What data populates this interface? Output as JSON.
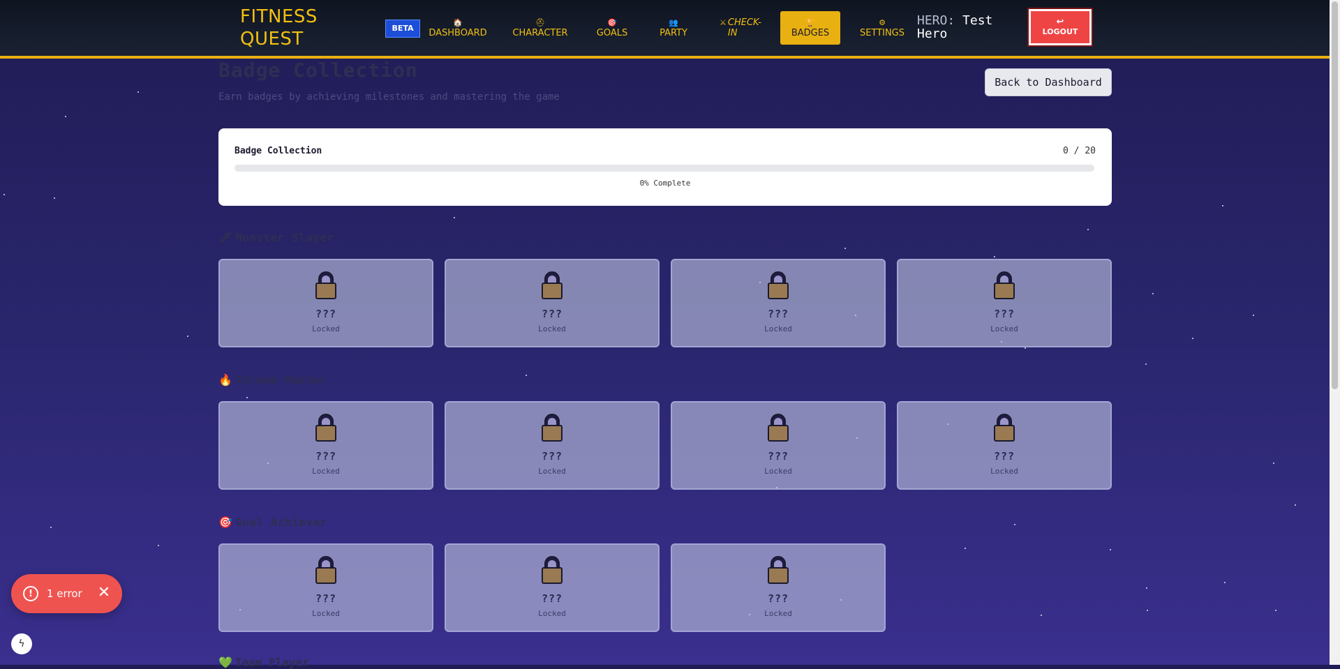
{
  "app": {
    "logo_line1": "FITNESS",
    "logo_line2": "QUEST",
    "beta_badge": "BETA"
  },
  "nav": [
    {
      "icon": "house-icon",
      "glyph": "🏠",
      "label": "DASHBOARD"
    },
    {
      "icon": "helmet-icon",
      "glyph": "⛑",
      "label": "CHARACTER"
    },
    {
      "icon": "target-icon",
      "glyph": "🎯",
      "label": "GOALS"
    },
    {
      "icon": "people-icon",
      "glyph": "👥",
      "label": "PARTY"
    },
    {
      "icon": "crossed-swords-icon",
      "glyph": "⚔",
      "label_line1": "CHECK-",
      "label_line2": "IN"
    },
    {
      "icon": "trophy-icon",
      "glyph": "🏆",
      "label": "BADGES"
    },
    {
      "icon": "gear-icon",
      "glyph": "⚙",
      "label": "SETTINGS"
    }
  ],
  "hero": {
    "prefix": "HERO:",
    "name_line1": "Test",
    "name_line2": "Hero"
  },
  "logout": {
    "glyph": "↩",
    "label": "LOGOUT"
  },
  "page": {
    "title": "Badge Collection",
    "subtitle": "Earn badges by achieving milestones and mastering the game",
    "back_button": "Back to Dashboard"
  },
  "progress": {
    "title": "Badge Collection",
    "count": "0 / 20",
    "percent_complete": 0,
    "label": "0% Complete"
  },
  "sections": [
    {
      "icon": "sword-icon",
      "glyph": "🗡",
      "title": "Monster Slayer",
      "badges": [
        {
          "name": "???",
          "status": "Locked"
        },
        {
          "name": "???",
          "status": "Locked"
        },
        {
          "name": "???",
          "status": "Locked"
        },
        {
          "name": "???",
          "status": "Locked"
        }
      ]
    },
    {
      "icon": "fire-icon",
      "glyph": "🔥",
      "title": "Streak Master",
      "badges": [
        {
          "name": "???",
          "status": "Locked"
        },
        {
          "name": "???",
          "status": "Locked"
        },
        {
          "name": "???",
          "status": "Locked"
        },
        {
          "name": "???",
          "status": "Locked"
        }
      ]
    },
    {
      "icon": "target-icon",
      "glyph": "🎯",
      "title": "Goal Achiever",
      "badges": [
        {
          "name": "???",
          "status": "Locked"
        },
        {
          "name": "???",
          "status": "Locked"
        },
        {
          "name": "???",
          "status": "Locked"
        }
      ]
    }
  ],
  "next_section_partial": {
    "icon": "heart-icon",
    "glyph": "💚",
    "title": "Team Player"
  },
  "error_toast": {
    "label": "1 error",
    "glyph": "!",
    "close_glyph": "✕"
  },
  "dev_indicator": {
    "glyph": "ϟ"
  },
  "colors": {
    "accent": "#e8b010",
    "logout": "#ef4444",
    "beta": "#1d4ed8",
    "error": "#ef5350"
  }
}
